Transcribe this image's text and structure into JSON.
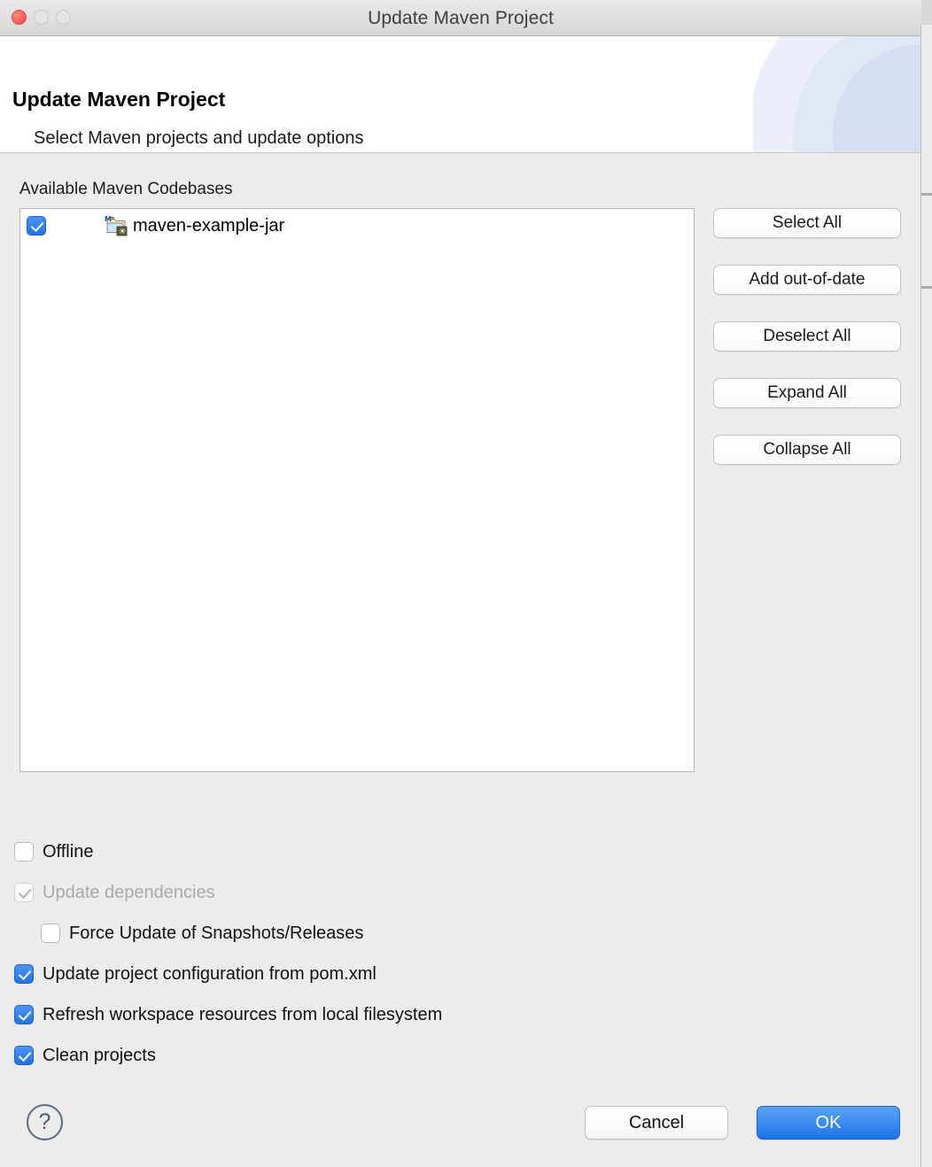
{
  "window": {
    "title": "Update Maven Project",
    "traffic_lights": [
      "close",
      "minimize",
      "maximize"
    ]
  },
  "header": {
    "title": "Update Maven Project",
    "subtitle": "Select Maven projects and update options"
  },
  "main": {
    "section_label": "Available Maven Codebases",
    "tree": {
      "items": [
        {
          "label": "maven-example-jar",
          "checked": true,
          "icon": "maven-project-icon"
        }
      ]
    },
    "side_buttons": [
      {
        "label": "Select All",
        "name": "select-all-button"
      },
      {
        "label": "Add out-of-date",
        "name": "add-out-of-date-button"
      },
      {
        "label": "Deselect All",
        "name": "deselect-all-button"
      },
      {
        "label": "Expand All",
        "name": "expand-all-button"
      },
      {
        "label": "Collapse All",
        "name": "collapse-all-button"
      }
    ],
    "options": [
      {
        "label": "Offline",
        "checked": false,
        "disabled": false,
        "indent": false,
        "name": "offline"
      },
      {
        "label": "Update dependencies",
        "checked": true,
        "disabled": true,
        "indent": false,
        "name": "update-dependencies"
      },
      {
        "label": "Force Update of Snapshots/Releases",
        "checked": false,
        "disabled": false,
        "indent": true,
        "name": "force-update-snapshots"
      },
      {
        "label": "Update project configuration from pom.xml",
        "checked": true,
        "disabled": false,
        "indent": false,
        "name": "update-project-configuration"
      },
      {
        "label": "Refresh workspace resources from local filesystem",
        "checked": true,
        "disabled": false,
        "indent": false,
        "name": "refresh-workspace-resources"
      },
      {
        "label": "Clean projects",
        "checked": true,
        "disabled": false,
        "indent": false,
        "name": "clean-projects"
      }
    ]
  },
  "footer": {
    "help_label": "?",
    "cancel_label": "Cancel",
    "ok_label": "OK"
  },
  "colors": {
    "accent_blue": "#1f73e8",
    "window_bg": "#ececec",
    "header_bg": "#ffffff",
    "banner_blue": "#d6dff1",
    "close_red": "#fc6058",
    "help_outline": "#5a6b84"
  }
}
